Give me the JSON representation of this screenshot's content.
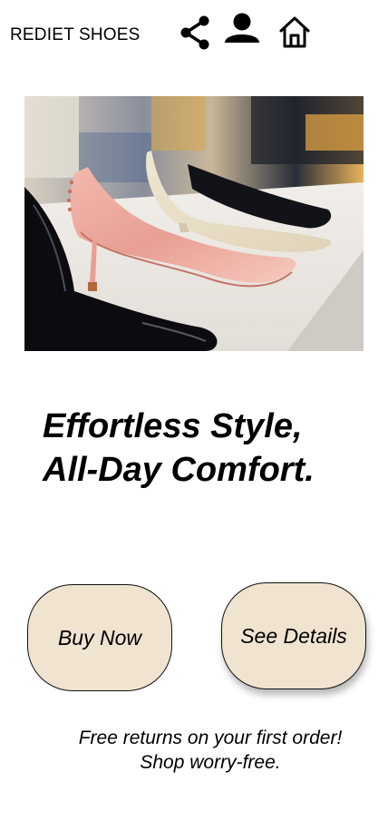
{
  "header": {
    "brand": "REDIET SHOES",
    "icons": [
      "share-icon",
      "user-icon",
      "home-icon"
    ]
  },
  "hero": {
    "image": "pink-patent-pump-on-store-shelf"
  },
  "headline": {
    "line1": "Effortless Style,",
    "line2": "All-Day Comfort."
  },
  "actions": {
    "buy_label": "Buy Now",
    "details_label": "See Details"
  },
  "promo": {
    "line1": "Free returns on your first order!",
    "line2": "Shop worry-free."
  },
  "colors": {
    "button_fill": "#f0e3d0",
    "background": "#ffffff",
    "text": "#000000"
  }
}
